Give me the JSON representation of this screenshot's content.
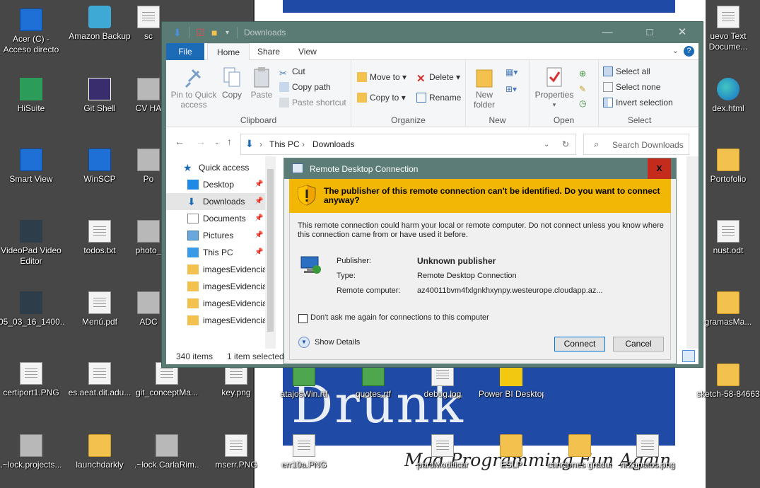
{
  "desktop": {
    "icons": [
      {
        "label": "Acer (C) - Acceso directo"
      },
      {
        "label": "Amazon Backup"
      },
      {
        "label": "HiSuite"
      },
      {
        "label": "Git Shell"
      },
      {
        "label": "CV HA"
      },
      {
        "label": "Smart View"
      },
      {
        "label": "WinSCP"
      },
      {
        "label": "Po"
      },
      {
        "label": "VideoPad Video Editor"
      },
      {
        "label": "todos.txt"
      },
      {
        "label": "photo_"
      },
      {
        "label": "05_03_16_1400..."
      },
      {
        "label": "Menú.pdf"
      },
      {
        "label": "ADC"
      },
      {
        "label": "certiport1.PNG"
      },
      {
        "label": "es.aeat.dit.adu..."
      },
      {
        "label": "git_conceptMa..."
      },
      {
        "label": "key.png"
      },
      {
        "label": ".~lock.projects..."
      },
      {
        "label": "launchdarkly"
      },
      {
        "label": ".~lock.CarlaRim..."
      },
      {
        "label": "mserr.PNG"
      },
      {
        "label": "atajosWin.rtf"
      },
      {
        "label": "quotes.rtf"
      },
      {
        "label": "debug.log"
      },
      {
        "label": "Power BI Desktop"
      },
      {
        "label": "err10a.PNG"
      },
      {
        "label": "paraModificar"
      },
      {
        "label": "ESLP"
      },
      {
        "label": "canciones gradua"
      },
      {
        "label": "nrZapatos.png"
      },
      {
        "label": "uevo Text Docume..."
      },
      {
        "label": "dex.html"
      },
      {
        "label": "Portofolio"
      },
      {
        "label": "nust.odt"
      },
      {
        "label": "gramasMa..."
      },
      {
        "label": "sketch-58-84663"
      },
      {
        "label": "sc"
      }
    ],
    "wallpaper": {
      "big_word": "Drunk",
      "tagline": "Mad Programming Fun Again"
    }
  },
  "explorer": {
    "title": "Downloads",
    "tabs": [
      "File",
      "Home",
      "Share",
      "View"
    ],
    "ribbon": {
      "clipboard": {
        "pin": "Pin to Quick access",
        "copy": "Copy",
        "paste": "Paste",
        "cut": "Cut",
        "copy_path": "Copy path",
        "paste_shortcut": "Paste shortcut",
        "group": "Clipboard"
      },
      "organize": {
        "move_to": "Move to",
        "copy_to": "Copy to",
        "delete": "Delete",
        "rename": "Rename",
        "group": "Organize"
      },
      "new": {
        "new_folder": "New folder",
        "group": "New"
      },
      "open": {
        "properties": "Properties",
        "group": "Open"
      },
      "select": {
        "select_all": "Select all",
        "select_none": "Select none",
        "invert": "Invert selection",
        "group": "Select"
      }
    },
    "address": {
      "root": "This PC",
      "current": "Downloads"
    },
    "search": {
      "placeholder": "Search Downloads"
    },
    "nav": [
      {
        "label": "Quick access"
      },
      {
        "label": "Desktop"
      },
      {
        "label": "Downloads"
      },
      {
        "label": "Documents"
      },
      {
        "label": "Pictures"
      },
      {
        "label": "This PC"
      },
      {
        "label": "imagesEvidencia"
      },
      {
        "label": "imagesEvidencia"
      },
      {
        "label": "imagesEvidencia"
      },
      {
        "label": "imagesEvidencia"
      }
    ],
    "status": {
      "count": "340 items",
      "selected": "1 item selected"
    }
  },
  "rdp": {
    "title": "Remote Desktop Connection",
    "close": "x",
    "warning": "The publisher of this remote connection can't be identified. Do you want to connect anyway?",
    "description": "This remote connection could harm your local or remote computer. Do not connect unless you know where this connection came from or have used it before.",
    "publisher_label": "Publisher:",
    "publisher_value": "Unknown publisher",
    "type_label": "Type:",
    "type_value": "Remote Desktop Connection",
    "computer_label": "Remote computer:",
    "computer_value": "az40011bvm4fxlgnkhxynpy.westeurope.cloudapp.az...",
    "dont_ask": "Don't ask me again for connections to this computer",
    "show_details": "Show Details",
    "connect": "Connect",
    "cancel": "Cancel"
  }
}
